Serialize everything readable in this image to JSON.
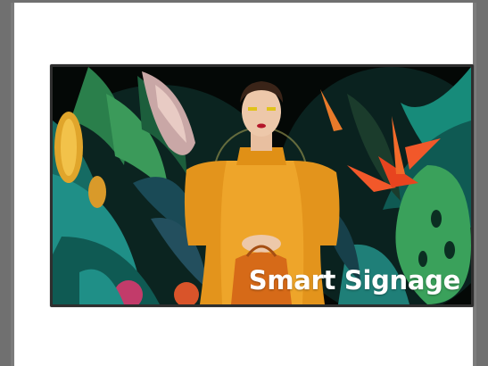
{
  "display": {
    "headline": "Smart Signage"
  },
  "colors": {
    "background": "#707070",
    "page": "#ffffff",
    "bezel": "#2e2e2e",
    "dress": "#e3941c",
    "foliage_dark": "#0f3a36",
    "foliage_teal": "#1f8f87",
    "flower_orange": "#f2582a"
  }
}
